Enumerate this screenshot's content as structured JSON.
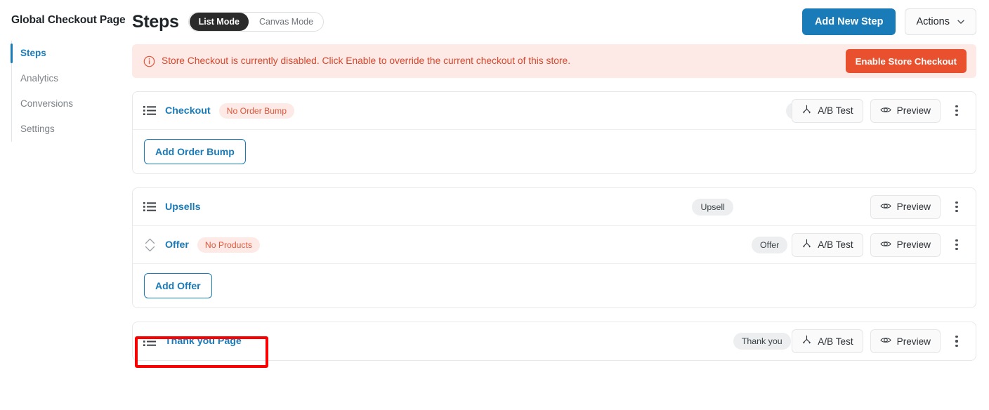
{
  "sidebar": {
    "title": "Global Checkout Page",
    "items": [
      {
        "label": "Steps",
        "active": true
      },
      {
        "label": "Analytics",
        "active": false
      },
      {
        "label": "Conversions",
        "active": false
      },
      {
        "label": "Settings",
        "active": false
      }
    ]
  },
  "header": {
    "title": "Steps",
    "mode_toggle": {
      "options": [
        "List Mode",
        "Canvas Mode"
      ],
      "selected": "List Mode"
    },
    "add_new_step_label": "Add New Step",
    "actions_label": "Actions",
    "chevron_icon": "chevron-down-icon"
  },
  "alert": {
    "icon": "info-circle-icon",
    "message": "Store Checkout is currently disabled. Click Enable to override the current checkout of this store.",
    "button_label": "Enable Store Checkout",
    "bg_color": "#fdeae6",
    "text_color": "#d9462b",
    "button_color": "#e8502e"
  },
  "labels": {
    "ab_test": "A/B Test",
    "preview": "Preview",
    "ab_test_icon": "ab-split-icon",
    "preview_icon": "eye-icon",
    "kebab_icon": "more-vertical-icon",
    "drag_icon": "list-lines-icon",
    "sort_icon": "sort-updown-icon"
  },
  "cards": [
    {
      "rows": [
        {
          "name": "Checkout",
          "badge": "No Order Bump",
          "type": "Checkout",
          "icon": "list-lines-icon",
          "ab_test": true,
          "preview": true
        }
      ],
      "action_button": "Add Order Bump"
    },
    {
      "rows": [
        {
          "name": "Upsells",
          "badge": null,
          "type": "Upsell",
          "icon": "list-lines-icon",
          "ab_test": false,
          "preview": true
        },
        {
          "name": "Offer",
          "badge": "No Products",
          "type": "Offer",
          "icon": "sort-updown-icon",
          "ab_test": true,
          "preview": true
        }
      ],
      "action_button": "Add Offer"
    },
    {
      "rows": [
        {
          "name": "Thank you Page",
          "badge": null,
          "type": "Thank you",
          "icon": "list-lines-icon",
          "ab_test": true,
          "preview": true,
          "highlighted": true
        }
      ],
      "action_button": null
    }
  ],
  "highlight": {
    "color": "#fb0000",
    "target": "Thank you Page"
  }
}
